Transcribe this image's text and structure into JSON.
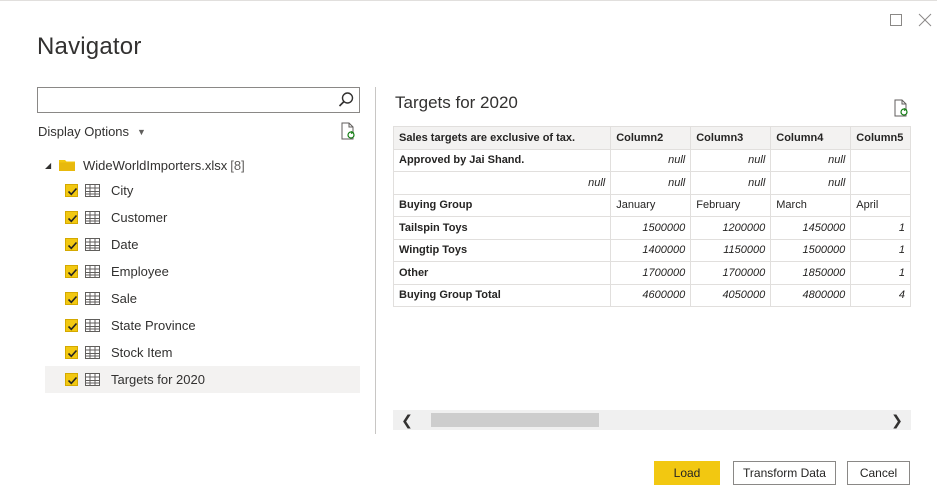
{
  "window": {
    "title": "Navigator"
  },
  "left": {
    "search": {
      "value": "",
      "placeholder": ""
    },
    "display_options_label": "Display Options",
    "tree": {
      "root_label": "WideWorldImporters.xlsx",
      "root_count": "[8]",
      "items": [
        {
          "label": "City",
          "checked": true,
          "selected": false
        },
        {
          "label": "Customer",
          "checked": true,
          "selected": false
        },
        {
          "label": "Date",
          "checked": true,
          "selected": false
        },
        {
          "label": "Employee",
          "checked": true,
          "selected": false
        },
        {
          "label": "Sale",
          "checked": true,
          "selected": false
        },
        {
          "label": "State Province",
          "checked": true,
          "selected": false
        },
        {
          "label": "Stock Item",
          "checked": true,
          "selected": false
        },
        {
          "label": "Targets for 2020",
          "checked": true,
          "selected": true
        }
      ]
    }
  },
  "preview": {
    "title": "Targets for 2020",
    "columns": [
      "Sales targets are exclusive of tax.",
      "Column2",
      "Column3",
      "Column4",
      "Column5"
    ],
    "rows": [
      [
        "Approved by Jai Shand.",
        "null",
        "null",
        "null",
        ""
      ],
      [
        "null",
        "null",
        "null",
        "null",
        ""
      ],
      [
        "Buying Group",
        "January",
        "February",
        "March",
        "April"
      ],
      [
        "Tailspin Toys",
        "1500000",
        "1200000",
        "1450000",
        "1"
      ],
      [
        "Wingtip Toys",
        "1400000",
        "1150000",
        "1500000",
        "1"
      ],
      [
        "Other",
        "1700000",
        "1700000",
        "1850000",
        "1"
      ],
      [
        "Buying Group Total",
        "4600000",
        "4050000",
        "4800000",
        "4"
      ]
    ]
  },
  "buttons": {
    "load": "Load",
    "transform": "Transform Data",
    "cancel": "Cancel"
  },
  "colors": {
    "accent": "#f2c811",
    "selected_bg": "#f3f2f1",
    "border": "#8a8886"
  }
}
